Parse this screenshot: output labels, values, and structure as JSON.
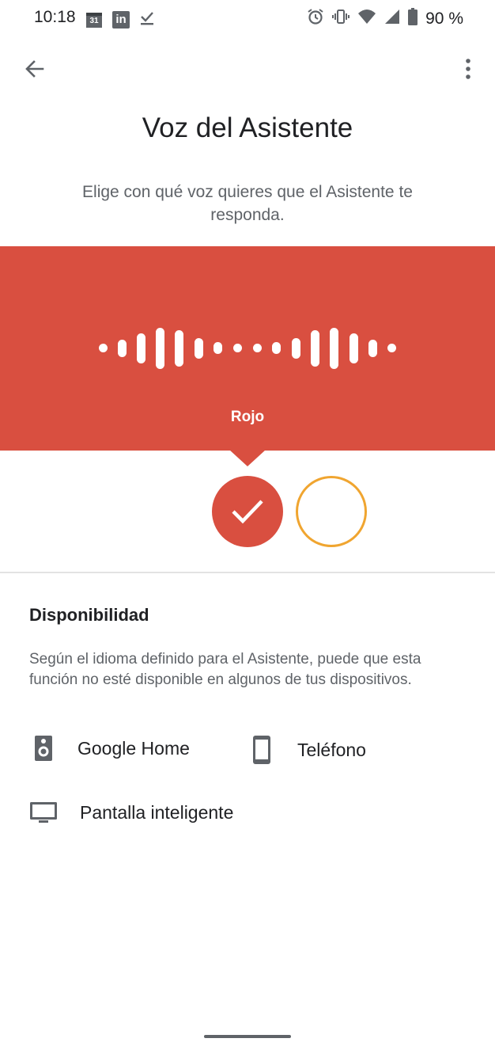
{
  "status_bar": {
    "time": "10:18",
    "calendar_day": "31",
    "linkedin": "in",
    "battery": "90 %",
    "left_icons": [
      "calendar-icon",
      "linkedin-icon",
      "task-done-icon"
    ],
    "right_icons": [
      "alarm-icon",
      "vibrate-icon",
      "wifi-icon",
      "signal-icon",
      "battery-icon"
    ]
  },
  "toolbar": {
    "back_icon": "arrow-back-icon",
    "more_icon": "more-vert-icon"
  },
  "header": {
    "title": "Voz del Asistente",
    "subtitle": "Elige con qué voz quieres que el Asistente te responda."
  },
  "voice_banner": {
    "selected_voice": "Rojo",
    "background_color": "#d94f40",
    "waveform_icon": "audio-waveform-icon"
  },
  "voice_options": [
    {
      "color": "#d94f40",
      "selected": true,
      "icon": "check-icon"
    },
    {
      "color": "#f0a530",
      "selected": false
    }
  ],
  "availability": {
    "title": "Disponibilidad",
    "description": "Según el idioma definido para el Asistente, puede que esta función no esté disponible en algunos de tus dispositivos.",
    "devices": [
      {
        "label": "Google Home",
        "icon": "speaker-icon"
      },
      {
        "label": "Teléfono",
        "icon": "smartphone-icon"
      },
      {
        "label": "Pantalla inteligente",
        "icon": "smart-display-icon"
      }
    ]
  }
}
